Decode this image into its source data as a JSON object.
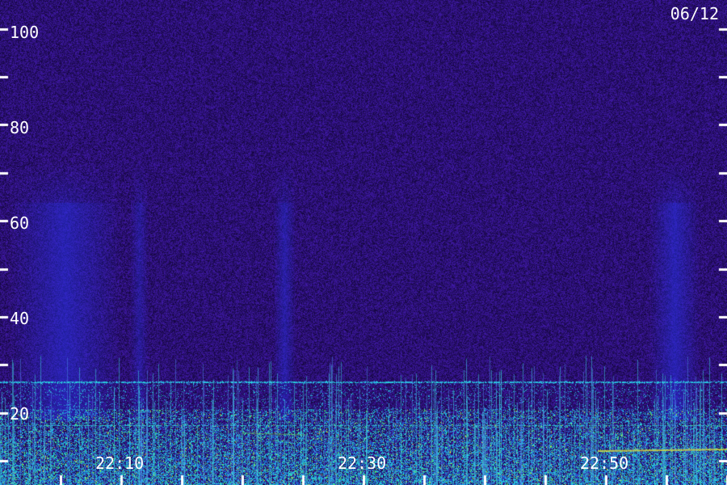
{
  "date": "06/12",
  "y_axis": {
    "tick_labels": [
      "100",
      "80",
      "60",
      "40",
      "20"
    ],
    "tick_values": [
      100,
      80,
      60,
      40,
      20
    ],
    "minor_tick_values": [
      90,
      70,
      50,
      30,
      10
    ],
    "range": [
      5,
      106
    ]
  },
  "x_axis": {
    "tick_labels": [
      "22:10",
      "22:30",
      "22:50"
    ],
    "tick_minutes": [
      10,
      30,
      50
    ],
    "range_minutes": [
      0,
      60
    ],
    "minor_tick_minutes": [
      5,
      15,
      20,
      25,
      35,
      40,
      45,
      55,
      60
    ]
  },
  "colors": {
    "background": "#1a0a4a",
    "noise_dark": "#140838",
    "noise_purple": "#3a1a90",
    "band_blue": "#2a3ad0",
    "band_cyan": "#30d0e0",
    "band_green": "#60e040",
    "band_yellow": "#e0e040",
    "tick": "#ffffff"
  }
}
